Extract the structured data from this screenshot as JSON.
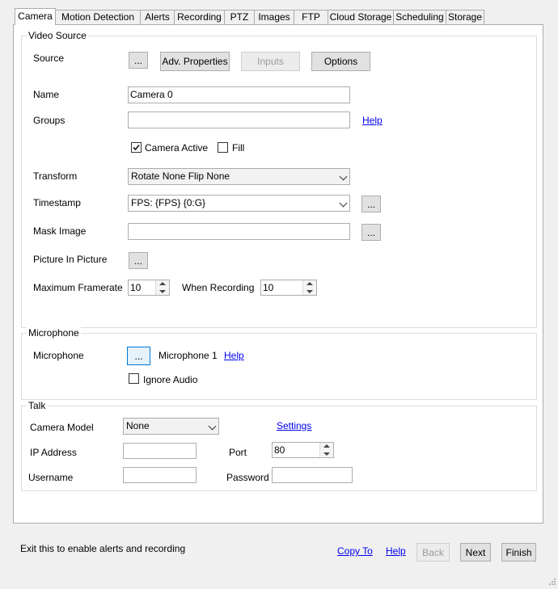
{
  "tabs": [
    {
      "label": "Camera",
      "active": true
    },
    {
      "label": "Motion Detection",
      "active": false
    },
    {
      "label": "Alerts",
      "active": false
    },
    {
      "label": "Recording",
      "active": false
    },
    {
      "label": "PTZ",
      "active": false
    },
    {
      "label": "Images",
      "active": false
    },
    {
      "label": "FTP",
      "active": false
    },
    {
      "label": "Cloud Storage",
      "active": false
    },
    {
      "label": "Scheduling",
      "active": false
    },
    {
      "label": "Storage",
      "active": false
    }
  ],
  "video_source": {
    "title": "Video Source",
    "source_label": "Source",
    "browse_label": "...",
    "adv_properties_label": "Adv. Properties",
    "inputs_label": "Inputs",
    "options_label": "Options",
    "name_label": "Name",
    "name_value": "Camera 0",
    "groups_label": "Groups",
    "groups_value": "",
    "help_label": "Help",
    "camera_active_label": "Camera Active",
    "camera_active_checked": true,
    "fill_label": "Fill",
    "fill_checked": false,
    "transform_label": "Transform",
    "transform_value": "Rotate None Flip None",
    "timestamp_label": "Timestamp",
    "timestamp_value": "FPS: {FPS} {0:G}",
    "timestamp_browse": "...",
    "mask_image_label": "Mask Image",
    "mask_image_value": "",
    "mask_browse": "...",
    "pip_label": "Picture In Picture",
    "pip_browse": "...",
    "max_framerate_label": "Maximum Framerate",
    "max_framerate_value": "10",
    "when_recording_label": "When Recording",
    "when_recording_value": "10"
  },
  "microphone": {
    "title": "Microphone",
    "microphone_label": "Microphone",
    "browse_label": "...",
    "microphone_value": "Microphone 1",
    "help_label": "Help",
    "ignore_audio_label": "Ignore Audio",
    "ignore_audio_checked": false
  },
  "talk": {
    "title": "Talk",
    "camera_model_label": "Camera Model",
    "camera_model_value": "None",
    "settings_label": "Settings",
    "ip_address_label": "IP Address",
    "ip_address_value": "",
    "port_label": "Port",
    "port_value": "80",
    "username_label": "Username",
    "username_value": "",
    "password_label": "Password",
    "password_value": ""
  },
  "footer": {
    "status_text": "Exit this to enable alerts and recording",
    "copy_to_label": "Copy To",
    "help_label": "Help",
    "back_label": "Back",
    "next_label": "Next",
    "finish_label": "Finish"
  }
}
